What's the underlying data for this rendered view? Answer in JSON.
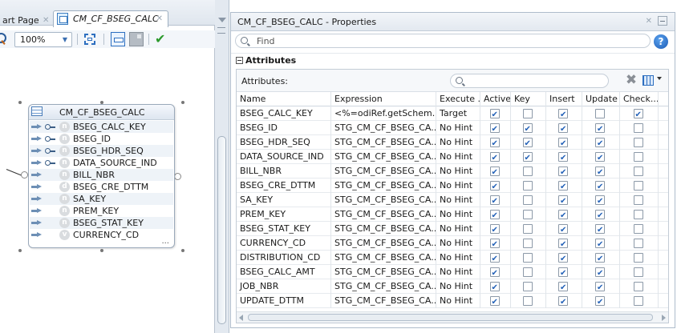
{
  "editor_tabs": {
    "start_page": "art Page",
    "active": "CM_CF_BSEG_CALC"
  },
  "toolbar": {
    "zoom": "100%"
  },
  "diagram": {
    "node_title": "CM_CF_BSEG_CALC",
    "attributes": [
      {
        "name": "BSEG_CALC_KEY",
        "key": true,
        "type": "n"
      },
      {
        "name": "BSEG_ID",
        "key": true,
        "type": "n"
      },
      {
        "name": "BSEG_HDR_SEQ",
        "key": true,
        "type": "n"
      },
      {
        "name": "DATA_SOURCE_IND",
        "key": true,
        "type": "n"
      },
      {
        "name": "BILL_NBR",
        "key": false,
        "type": "n"
      },
      {
        "name": "BSEG_CRE_DTTM",
        "key": false,
        "type": "d"
      },
      {
        "name": "SA_KEY",
        "key": false,
        "type": "n"
      },
      {
        "name": "PREM_KEY",
        "key": false,
        "type": "n"
      },
      {
        "name": "BSEG_STAT_KEY",
        "key": false,
        "type": "n"
      },
      {
        "name": "CURRENCY_CD",
        "key": false,
        "type": "v"
      }
    ],
    "more": "..."
  },
  "properties": {
    "title": "CM_CF_BSEG_CALC - Properties",
    "find_placeholder": "Find",
    "section": "Attributes",
    "attributes_label": "Attributes:",
    "columns": {
      "name": "Name",
      "expression": "Expression",
      "execute": "Execute ...",
      "active": "Active",
      "key": "Key",
      "insert": "Insert",
      "update": "Update",
      "check": "Check..."
    },
    "rows": [
      {
        "name": "BSEG_CALC_KEY",
        "expr": "<%=odiRef.getSchem...",
        "exec": "Target",
        "active": true,
        "key": false,
        "insert": true,
        "update": false,
        "check": true
      },
      {
        "name": "BSEG_ID",
        "expr": "STG_CM_CF_BSEG_CA...",
        "exec": "No Hint",
        "active": true,
        "key": true,
        "insert": true,
        "update": true,
        "check": false
      },
      {
        "name": "BSEG_HDR_SEQ",
        "expr": "STG_CM_CF_BSEG_CA...",
        "exec": "No Hint",
        "active": true,
        "key": true,
        "insert": true,
        "update": true,
        "check": false
      },
      {
        "name": "DATA_SOURCE_IND",
        "expr": "STG_CM_CF_BSEG_CA...",
        "exec": "No Hint",
        "active": true,
        "key": true,
        "insert": true,
        "update": true,
        "check": false
      },
      {
        "name": "BILL_NBR",
        "expr": "STG_CM_CF_BSEG_CA...",
        "exec": "No Hint",
        "active": true,
        "key": false,
        "insert": true,
        "update": true,
        "check": false
      },
      {
        "name": "BSEG_CRE_DTTM",
        "expr": "STG_CM_CF_BSEG_CA...",
        "exec": "No Hint",
        "active": true,
        "key": false,
        "insert": true,
        "update": true,
        "check": false
      },
      {
        "name": "SA_KEY",
        "expr": "STG_CM_CF_BSEG_CA...",
        "exec": "No Hint",
        "active": true,
        "key": false,
        "insert": true,
        "update": true,
        "check": false
      },
      {
        "name": "PREM_KEY",
        "expr": "STG_CM_CF_BSEG_CA...",
        "exec": "No Hint",
        "active": true,
        "key": false,
        "insert": true,
        "update": true,
        "check": false
      },
      {
        "name": "BSEG_STAT_KEY",
        "expr": "STG_CM_CF_BSEG_CA...",
        "exec": "No Hint",
        "active": true,
        "key": false,
        "insert": true,
        "update": true,
        "check": false
      },
      {
        "name": "CURRENCY_CD",
        "expr": "STG_CM_CF_BSEG_CA...",
        "exec": "No Hint",
        "active": true,
        "key": false,
        "insert": true,
        "update": true,
        "check": false
      },
      {
        "name": "DISTRIBUTION_CD",
        "expr": "STG_CM_CF_BSEG_CA...",
        "exec": "No Hint",
        "active": true,
        "key": false,
        "insert": true,
        "update": true,
        "check": false
      },
      {
        "name": "BSEG_CALC_AMT",
        "expr": "STG_CM_CF_BSEG_CA...",
        "exec": "No Hint",
        "active": true,
        "key": false,
        "insert": true,
        "update": true,
        "check": false
      },
      {
        "name": "JOB_NBR",
        "expr": "STG_CM_CF_BSEG_CA...",
        "exec": "No Hint",
        "active": true,
        "key": false,
        "insert": true,
        "update": true,
        "check": false
      },
      {
        "name": "UPDATE_DTTM",
        "expr": "STG_CM_CF_BSEG_CA...",
        "exec": "No Hint",
        "active": true,
        "key": false,
        "insert": true,
        "update": true,
        "check": false
      }
    ]
  },
  "icons": {
    "zoom": "magnifier-icon",
    "fit": "fit-to-window-icon",
    "view": "view-icon",
    "validate": "check-icon",
    "help": "help-icon",
    "delete": "delete-icon",
    "columns": "grid-columns-icon"
  },
  "colors": {
    "checkmark": "#2462b8",
    "validate": "#2c9a2c",
    "help": "#1c5bb5"
  }
}
